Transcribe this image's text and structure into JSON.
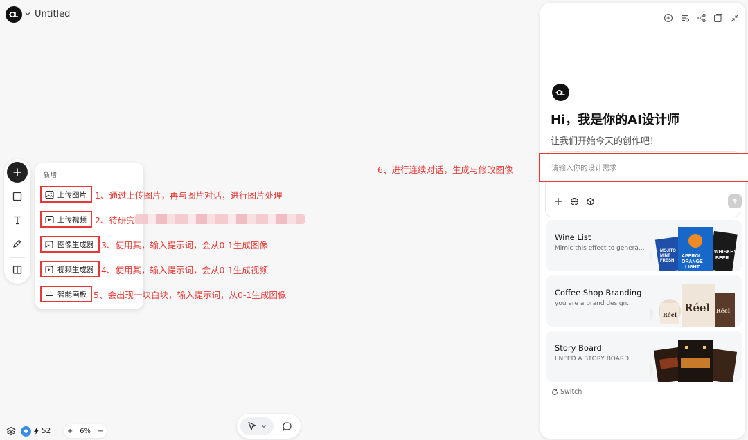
{
  "header": {
    "title": "Untitled"
  },
  "toolbar": {
    "tools": [
      "add-icon",
      "rectangle-icon",
      "text-icon",
      "pen-icon",
      "layout-icon"
    ]
  },
  "add_menu": {
    "heading": "新增",
    "items": [
      {
        "label": "上传图片",
        "icon": "image-upload-icon"
      },
      {
        "label": "上传视频",
        "icon": "video-upload-icon"
      },
      {
        "label": "图像生成器",
        "icon": "image-generate-icon"
      },
      {
        "label": "视频生成器",
        "icon": "video-generate-icon"
      },
      {
        "label": "智能画板",
        "icon": "hash-icon"
      }
    ]
  },
  "annotations": {
    "a1": "1、通过上传图片，再与图片对话，进行图片处理",
    "a2": "2、待研究",
    "a3": "3、使用其，输入提示词，会从0-1生成图像",
    "a4": "4、使用其，输入提示词，会从0-1生成视频",
    "a5": "5、会出现一块白块，输入提示词，从0-1生成图像",
    "a6": "6、进行连续对话，生成与修改图像"
  },
  "bottom_left": {
    "credits": "52",
    "zoom_plus": "+",
    "zoom_level": "6%",
    "zoom_minus": "−"
  },
  "panel": {
    "greeting": "Hi，我是你的AI设计师",
    "subgreeting": "让我们开始今天的创作吧！",
    "prompt_placeholder": "请输入你的设计需求",
    "cards": [
      {
        "title": "Wine List",
        "subtitle": "Mimic this effect to genera..."
      },
      {
        "title": "Coffee Shop Branding",
        "subtitle": "you are a brand design..."
      },
      {
        "title": "Story Board",
        "subtitle": "I NEED A STORY BOARD..."
      }
    ],
    "switch_label": "Switch",
    "deco": {
      "wine": [
        "MOJITO",
        "MINT",
        "FRESH",
        "APEROL",
        "ORANGE",
        "LIGHT",
        "WHISKEY",
        "BEER"
      ],
      "coffee": [
        "Réel",
        "Réel",
        "Réel"
      ]
    }
  },
  "colors": {
    "annotation": "#e53935",
    "dark": "#111111",
    "panel_bg": "#ffffff",
    "canvas_bg": "#f7f7f8"
  }
}
